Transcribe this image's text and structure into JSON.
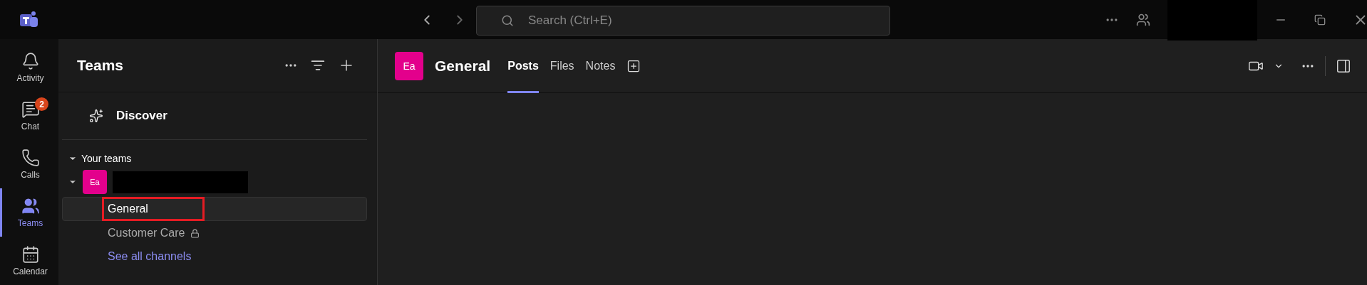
{
  "title_bar": {
    "search": {
      "placeholder": "Search (Ctrl+E)"
    },
    "account_redacted": true
  },
  "rail": [
    {
      "label": "Activity",
      "selected": false
    },
    {
      "label": "Chat",
      "selected": false,
      "badge": "2"
    },
    {
      "label": "Calls",
      "selected": false
    },
    {
      "label": "Teams",
      "selected": true
    },
    {
      "label": "Calendar",
      "selected": false
    }
  ],
  "sidebar": {
    "title": "Teams",
    "discover": "Discover",
    "section": {
      "label": "Your teams",
      "expanded": true
    },
    "team": {
      "initials": "Ea",
      "name_redacted": true,
      "expanded": true,
      "channels": [
        {
          "kind": "channel",
          "label": "General",
          "selected": true,
          "outlined": true,
          "private": false
        },
        {
          "kind": "channel",
          "label": "Customer Care",
          "selected": false,
          "outlined": false,
          "private": true
        },
        {
          "kind": "link",
          "label": "See all channels",
          "selected": false,
          "outlined": false,
          "private": false
        }
      ]
    }
  },
  "channel_header": {
    "initials": "Ea",
    "title": "General",
    "tabs": [
      {
        "label": "Posts",
        "selected": true
      },
      {
        "label": "Files",
        "selected": false
      },
      {
        "label": "Notes",
        "selected": false
      }
    ]
  }
}
